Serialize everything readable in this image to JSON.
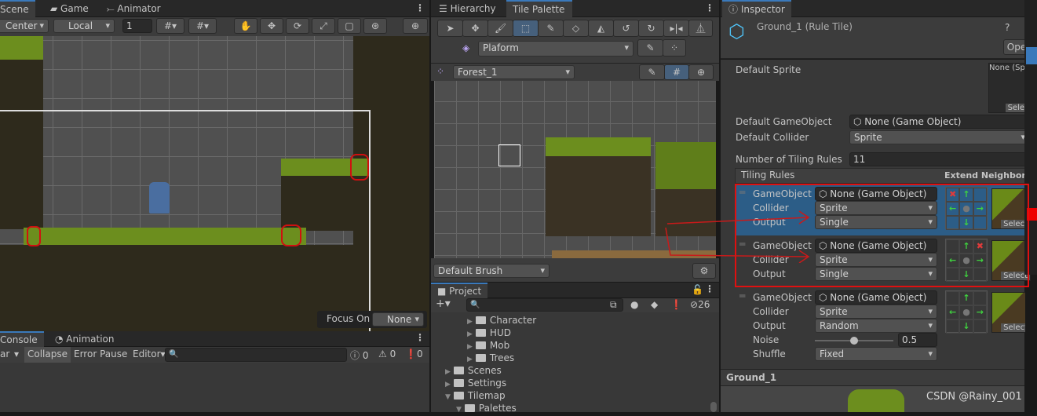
{
  "scene": {
    "tabs": [
      "Scene",
      "Game",
      "Animator"
    ],
    "pivot": "Center",
    "space": "Local",
    "grid_size": "1",
    "focus_label": "Focus On",
    "focus_value": "None"
  },
  "console": {
    "tabs": [
      "Console",
      "Animation"
    ],
    "clear": "ar",
    "collapse": "Collapse",
    "error_pause": "Error Pause",
    "editor": "Editor",
    "log_count": "0",
    "warn_count": "0",
    "error_count": "0"
  },
  "palette": {
    "tabs": [
      "Hierarchy",
      "Tile Palette"
    ],
    "tools": [
      "select",
      "move",
      "paint",
      "box-fill",
      "picker",
      "erase",
      "fill",
      "rotate-ccw",
      "rotate-cw",
      "flip-x",
      "flip-y"
    ],
    "active_tool": "box-fill",
    "layer": "Plaform",
    "palette_name": "Forest_1",
    "brush": "Default Brush"
  },
  "project": {
    "tab": "Project",
    "hidden_count": "26",
    "items": [
      {
        "label": "Character",
        "depth": 2,
        "open": false
      },
      {
        "label": "HUD",
        "depth": 2,
        "open": false
      },
      {
        "label": "Mob",
        "depth": 2,
        "open": false
      },
      {
        "label": "Trees",
        "depth": 2,
        "open": false
      },
      {
        "label": "Scenes",
        "depth": 1,
        "open": false
      },
      {
        "label": "Settings",
        "depth": 1,
        "open": false
      },
      {
        "label": "Tilemap",
        "depth": 1,
        "open": true
      },
      {
        "label": "Palettes",
        "depth": 2,
        "open": true
      }
    ]
  },
  "inspector": {
    "tab": "Inspector",
    "title": "Ground_1 (Rule Tile)",
    "open_btn": "Ope",
    "default_sprite_label": "Default Sprite",
    "default_sprite_value": "None (Sp",
    "select": "Sele",
    "default_go_label": "Default GameObject",
    "default_go_value": "None (Game Object)",
    "default_collider_label": "Default Collider",
    "default_collider_value": "Sprite",
    "num_rules_label": "Number of Tiling Rules",
    "num_rules_value": "11",
    "tiling_rules": "Tiling Rules",
    "extend_neighbor": "Extend Neighbor",
    "rules": [
      {
        "gameobject": "None (Game Object)",
        "collider": "Sprite",
        "output": "Single",
        "grid": [
          "x",
          "g",
          "",
          "g",
          "c",
          "g",
          "",
          "g",
          ""
        ],
        "selected": true
      },
      {
        "gameobject": "None (Game Object)",
        "collider": "Sprite",
        "output": "Single",
        "grid": [
          "",
          "g",
          "x",
          "g",
          "c",
          "g",
          "",
          "g",
          ""
        ],
        "selected": false
      },
      {
        "gameobject": "None (Game Object)",
        "collider": "Sprite",
        "output": "Random",
        "noise": "0.5",
        "noise_level": 0.5,
        "shuffle": "Fixed",
        "grid": [
          "",
          "g",
          "",
          "g",
          "c",
          "g",
          "",
          "g",
          ""
        ],
        "selected": false
      }
    ],
    "labels": {
      "gameobject": "GameObject",
      "collider": "Collider",
      "output": "Output",
      "noise": "Noise",
      "shuffle": "Shuffle",
      "select": "Select"
    },
    "preview_title": "Ground_1"
  },
  "watermark": "CSDN @Rainy_001",
  "colors": {
    "accent": "#3a79bb",
    "highlight": "#2c5d87",
    "annotation": "#e01010"
  }
}
